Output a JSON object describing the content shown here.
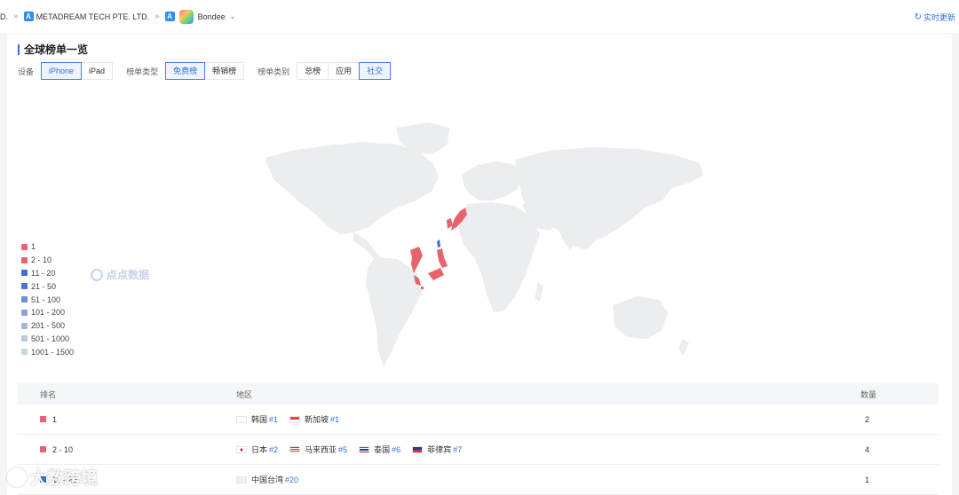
{
  "breadcrumb": {
    "prefix": "D.",
    "developer": "METADREAM TECH PTE. LTD.",
    "app_name": "Bondee"
  },
  "refresh_label": "实时更新",
  "section_title": "全球榜单一览",
  "filters": {
    "device": {
      "label": "设备",
      "options": [
        "iPhone",
        "iPad"
      ],
      "active": "iPhone"
    },
    "chart_type": {
      "label": "榜单类型",
      "options": [
        "免费榜",
        "畅销榜"
      ],
      "active": "免费榜"
    },
    "category": {
      "label": "榜单类别",
      "options": [
        "总榜",
        "应用",
        "社交"
      ],
      "active": "社交"
    }
  },
  "legend": [
    {
      "label": "1",
      "color": "#e8636b"
    },
    {
      "label": "2 - 10",
      "color": "#e8636b"
    },
    {
      "label": "11 - 20",
      "color": "#3e6be0"
    },
    {
      "label": "21 - 50",
      "color": "#4a72dc"
    },
    {
      "label": "51 - 100",
      "color": "#6f8ed6"
    },
    {
      "label": "101 - 200",
      "color": "#8da4d8"
    },
    {
      "label": "201 - 500",
      "color": "#a4b4dc"
    },
    {
      "label": "501 - 1000",
      "color": "#bcc7e2"
    },
    {
      "label": "1001 - 1500",
      "color": "#cdd5e8"
    }
  ],
  "watermark": "点点数据",
  "table": {
    "headers": {
      "rank": "排名",
      "region": "地区",
      "count": "数量"
    },
    "rows": [
      {
        "rank": "1",
        "color": "#e8636b",
        "regions": [
          {
            "name": "韩国",
            "rank": "#1",
            "flag": "kr"
          },
          {
            "name": "新加坡",
            "rank": "#1",
            "flag": "sg"
          }
        ],
        "count": "2"
      },
      {
        "rank": "2 - 10",
        "color": "#e8636b",
        "regions": [
          {
            "name": "日本",
            "rank": "#2",
            "flag": "jp"
          },
          {
            "name": "马来西亚",
            "rank": "#5",
            "flag": "my"
          },
          {
            "name": "泰国",
            "rank": "#6",
            "flag": "th"
          },
          {
            "name": "菲律宾",
            "rank": "#7",
            "flag": "ph"
          }
        ],
        "count": "4"
      },
      {
        "rank": "11 - 20",
        "color": "#3e6be0",
        "regions": [
          {
            "name": "中国台湾",
            "rank": "#20",
            "flag": "tw"
          }
        ],
        "count": "1"
      }
    ]
  },
  "bottom_watermark": "大数跨境",
  "map_colors": {
    "land": "#ecedf1",
    "rank_top": "#e8636b",
    "rank_mid": "#3e6be0"
  }
}
